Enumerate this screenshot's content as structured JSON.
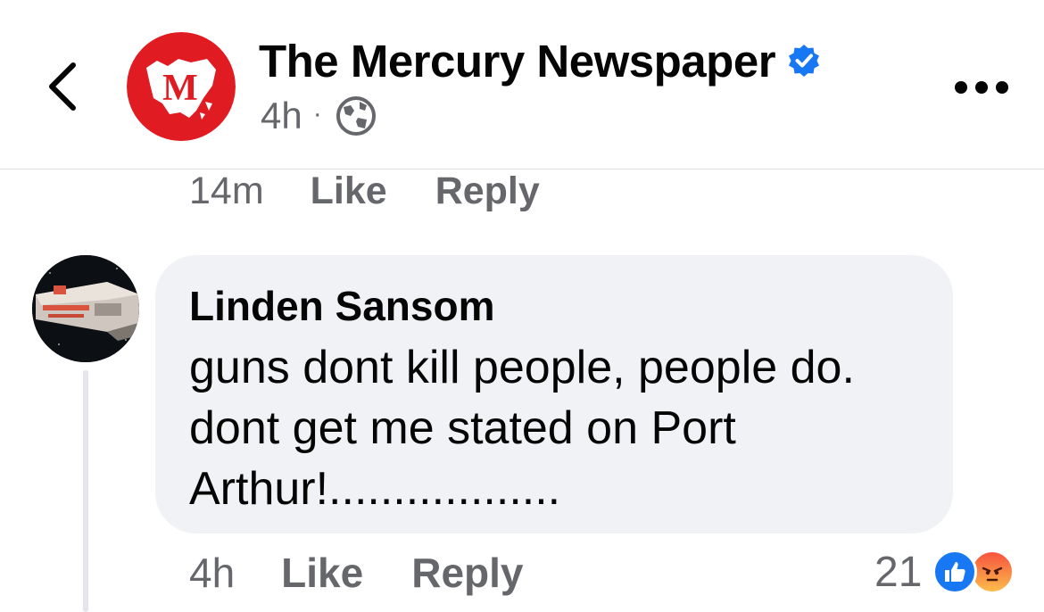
{
  "header": {
    "page_name": "The Mercury Newspaper",
    "post_time": "4h",
    "separator": "·",
    "logo_letter": "M",
    "icons": {
      "back": "chevron-left-icon",
      "verified": "verified-badge-icon",
      "audience": "globe-icon",
      "more": "more-horizontal-icon"
    },
    "colors": {
      "logo_red": "#e11b22",
      "verified_blue": "#1877f2"
    }
  },
  "previous_comment": {
    "time": "14m",
    "like_label": "Like",
    "reply_label": "Reply"
  },
  "comment": {
    "author": "Linden Sansom",
    "text_lines": [
      "guns dont kill people, people do.",
      "dont get me stated on Port",
      "Arthur!.................."
    ],
    "time": "4h",
    "like_label": "Like",
    "reply_label": "Reply",
    "reaction_count": "21",
    "reactions": [
      "like-icon",
      "angry-icon"
    ],
    "bubble_color": "#f0f2f5"
  }
}
